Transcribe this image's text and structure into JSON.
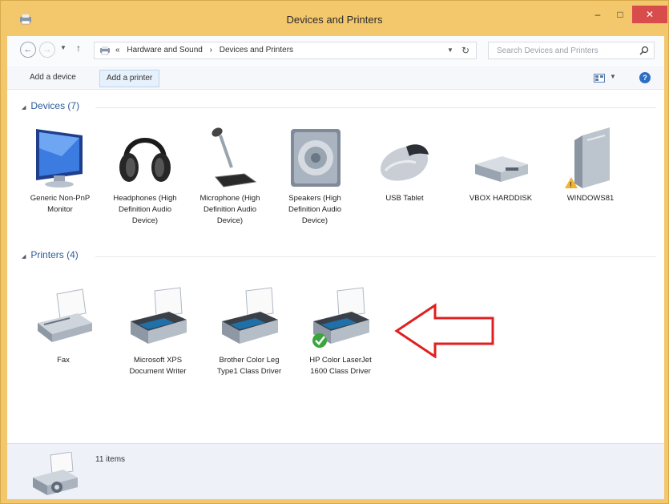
{
  "window": {
    "title": "Devices and Printers",
    "minimize_glyph": "–",
    "maximize_glyph": "□",
    "close_glyph": "✕"
  },
  "nav": {
    "back_icon": "back-arrow-icon",
    "forward_icon": "forward-arrow-icon",
    "breadcrumb_prefix": "«",
    "breadcrumbs": [
      "Hardware and Sound",
      "Devices and Printers"
    ],
    "separator": "›",
    "search_placeholder": "Search Devices and Printers"
  },
  "toolbar": {
    "add_device_label": "Add a device",
    "add_printer_label": "Add a printer"
  },
  "groups": {
    "devices": {
      "header": "Devices (7)",
      "items": [
        {
          "label": "Generic Non-PnP Monitor",
          "icon": "monitor-icon"
        },
        {
          "label": "Headphones (High Definition Audio Device)",
          "icon": "headphones-icon"
        },
        {
          "label": "Microphone (High Definition Audio Device)",
          "icon": "microphone-icon"
        },
        {
          "label": "Speakers (High Definition Audio Device)",
          "icon": "speaker-icon"
        },
        {
          "label": "USB Tablet",
          "icon": "mouse-icon"
        },
        {
          "label": "VBOX HARDDISK",
          "icon": "harddisk-icon"
        },
        {
          "label": "WINDOWS81",
          "icon": "computer-tower-icon"
        }
      ]
    },
    "printers": {
      "header": "Printers (4)",
      "items": [
        {
          "label": "Fax",
          "icon": "fax-icon"
        },
        {
          "label": "Microsoft XPS Document Writer",
          "icon": "printer-icon"
        },
        {
          "label": "Brother Color Leg Type1 Class Driver",
          "icon": "printer-icon"
        },
        {
          "label": "HP Color LaserJet 1600 Class Driver",
          "icon": "printer-default-icon"
        }
      ]
    }
  },
  "details": {
    "count_text": "11 items"
  },
  "colors": {
    "titlebar": "#f3c76c",
    "close": "#d84c4c",
    "group_header": "#2b5a9c",
    "arrow": "#e02020"
  }
}
